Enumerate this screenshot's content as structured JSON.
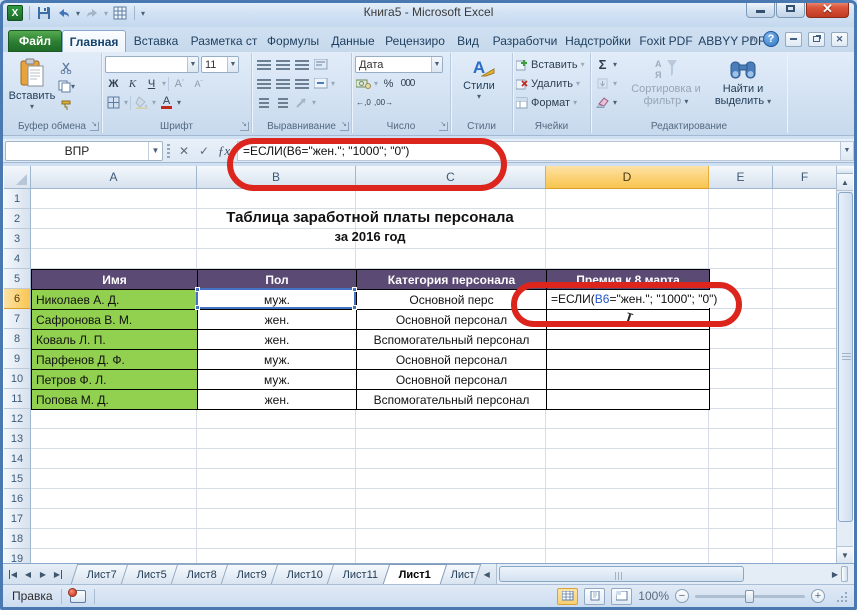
{
  "window": {
    "title": "Книга5  -  Microsoft Excel"
  },
  "ribbon_tabs": [
    {
      "label": "Файл"
    },
    {
      "label": "Главная"
    },
    {
      "label": "Вставка"
    },
    {
      "label": "Разметка ст"
    },
    {
      "label": "Формулы"
    },
    {
      "label": "Данные"
    },
    {
      "label": "Рецензиро"
    },
    {
      "label": "Вид"
    },
    {
      "label": "Разработчи"
    },
    {
      "label": "Надстройки"
    },
    {
      "label": "Foxit PDF"
    },
    {
      "label": "ABBYY PDF T"
    }
  ],
  "active_tab": "Главная",
  "ribbon": {
    "clipboard": {
      "label": "Буфер обмена",
      "paste": "Вставить"
    },
    "font": {
      "label": "Шрифт",
      "size": "11",
      "bold": "Ж",
      "italic": "К",
      "underline": "Ч",
      "grow": "А",
      "shrink": "А",
      "color_letter": "А"
    },
    "alignment": {
      "label": "Выравнивание"
    },
    "number": {
      "label": "Число",
      "format": "Дата",
      "percent": "%",
      "thousands": "000",
      "dec_inc": "←,0",
      "dec_dec": ",00→"
    },
    "styles": {
      "label": "Стили",
      "button": "Стили",
      "icon_letter": "А"
    },
    "cells": {
      "label": "Ячейки",
      "insert": "Вставить",
      "delete": "Удалить",
      "format": "Формат"
    },
    "editing": {
      "label": "Редактирование",
      "autosum": "Σ",
      "sort": "Сортировка и фильтр",
      "find": "Найти и выделить"
    }
  },
  "formula_bar": {
    "name_box": "ВПР",
    "fx": "ƒx",
    "formula": "=ЕСЛИ(B6=\"жен.\"; \"1000\"; \"0\")"
  },
  "formula_parts": {
    "head": "=ЕСЛИ(",
    "ref": "B6",
    "tail": "=\"жен.\"; \"1000\"; \"0\")"
  },
  "grid": {
    "columns": [
      "A",
      "B",
      "C",
      "D",
      "E",
      "F"
    ],
    "selected_column": "D",
    "row_numbers": [
      "1",
      "2",
      "3",
      "4",
      "5",
      "6",
      "7",
      "8",
      "9",
      "10",
      "11",
      "12",
      "13",
      "14",
      "15",
      "16",
      "17",
      "18",
      "19"
    ],
    "selected_row": "6"
  },
  "table": {
    "title": "Таблица заработной платы персонала",
    "subtitle": "за 2016 год",
    "headers": [
      "Имя",
      "Пол",
      "Категория персонала",
      "Премия к 8 марта"
    ],
    "rows": [
      {
        "name": "Николаев А. Д.",
        "gender": "муж.",
        "category": "Основной перс",
        "bonus": ""
      },
      {
        "name": "Сафронова В. М.",
        "gender": "жен.",
        "category": "Основной персонал",
        "bonus": ""
      },
      {
        "name": "Коваль Л. П.",
        "gender": "жен.",
        "category": "Вспомогательный персонал",
        "bonus": ""
      },
      {
        "name": "Парфенов Д. Ф.",
        "gender": "муж.",
        "category": "Основной персонал",
        "bonus": ""
      },
      {
        "name": "Петров Ф. Л.",
        "gender": "муж.",
        "category": "Основной персонал",
        "bonus": ""
      },
      {
        "name": "Попова М. Д.",
        "gender": "жен.",
        "category": "Вспомогательный персонал",
        "bonus": ""
      }
    ]
  },
  "sheet_bar": {
    "tabs": [
      "Лист7",
      "Лист5",
      "Лист8",
      "Лист9",
      "Лист10",
      "Лист11",
      "Лист1",
      "Лист"
    ],
    "active": "Лист1"
  },
  "status_bar": {
    "mode": "Правка",
    "zoom": "100%"
  },
  "colors": {
    "file_tab_green": "#2c7f32",
    "header_purple": "#5b4a73",
    "cell_green": "#92d050",
    "selection_orange": "#f8c550",
    "annotation_red": "#dc251c",
    "ref_blue": "#2456c9"
  }
}
